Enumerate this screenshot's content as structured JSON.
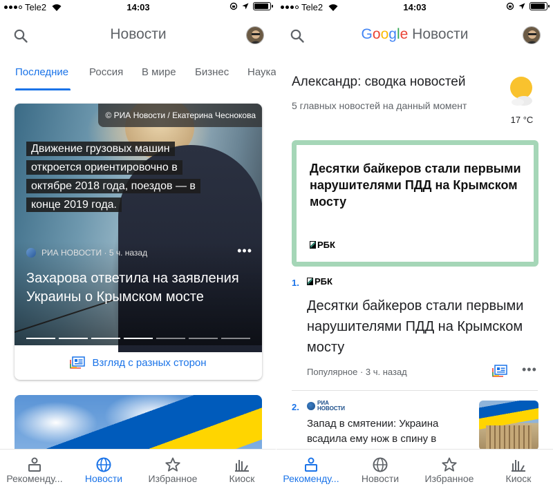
{
  "status_bar": {
    "carrier": "Tele2",
    "time": "14:03"
  },
  "left": {
    "app_title": "Новости",
    "tabs": [
      {
        "label": "Последние",
        "active": true
      },
      {
        "label": "Россия",
        "active": false
      },
      {
        "label": "В мире",
        "active": false
      },
      {
        "label": "Бизнес",
        "active": false
      },
      {
        "label": "Наука",
        "active": false
      }
    ],
    "hero": {
      "photo_credit": "© РИА Новости / Екатерина Чеснокова",
      "quote": "Движение грузовых машин откроется ориентировочно в октябре 2018 года, поездов — в конце 2019 года.",
      "source": "РИА НОВОСТИ",
      "time_ago": "5 ч. назад",
      "title": "Захарова ответила на заявления Украины о Крымском мосте",
      "perspectives_label": "Взгляд с разных сторон",
      "slides_total": 7,
      "slide_current": 4
    }
  },
  "right": {
    "logo_google": "Google",
    "logo_news": "Новости",
    "briefing_title": "Александр: сводка новостей",
    "briefing_subtitle": "5 главных новостей на данный момент",
    "weather": {
      "icon": "partly-cloudy-icon",
      "temperature": "17 °C"
    },
    "featured": {
      "title": "Десятки байкеров стали первыми нарушителями ПДД на Крымском мосту",
      "source": "РБК"
    },
    "items": [
      {
        "number": "1.",
        "source": "РБК",
        "title": "Десятки байкеров стали первыми нарушителями ПДД на Крымском мосту",
        "tag": "Популярное",
        "time_ago": "3 ч. назад"
      },
      {
        "number": "2.",
        "source_line1": "РИА",
        "source_line2": "НОВОСТИ",
        "title": "Запад в смятении: Украина всадила ему нож в спину в"
      }
    ]
  },
  "bottom_nav": [
    {
      "label": "Рекоменду...",
      "icon": "for-you-icon"
    },
    {
      "label": "Новости",
      "icon": "globe-icon"
    },
    {
      "label": "Избранное",
      "icon": "star-icon"
    },
    {
      "label": "Киоск",
      "icon": "newsstand-icon"
    }
  ],
  "colors": {
    "accent": "#1a73e8",
    "feature_border": "#a5d6b7",
    "text_secondary": "#5f6368"
  }
}
